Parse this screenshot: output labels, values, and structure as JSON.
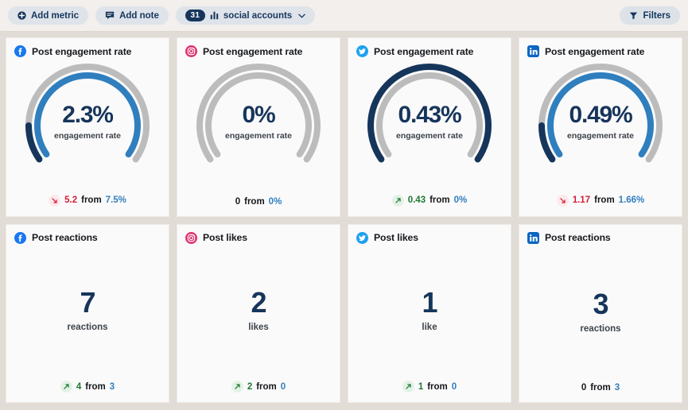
{
  "toolbar": {
    "add_metric_label": "Add metric",
    "add_note_label": "Add note",
    "accounts_count": "31",
    "accounts_label": "social accounts",
    "chevron": "⌄",
    "filters_label": "Filters",
    "icons": {
      "plus": "plus-circle-icon",
      "note": "note-icon",
      "bars": "bar-chart-icon",
      "funnel": "funnel-icon"
    }
  },
  "cards": [
    {
      "network": "facebook",
      "title": "Post engagement rate",
      "type": "gauge",
      "value": "2.3%",
      "unit_label": "engagement rate",
      "gauge": {
        "current_pct": 2.3,
        "previous_pct": 7.5,
        "max_pct": 7.5,
        "outer_mode": "previous",
        "inner_mode": "current"
      },
      "delta": {
        "direction": "down",
        "value": "5.2",
        "from_label": "from",
        "previous": "7.5%"
      }
    },
    {
      "network": "instagram",
      "title": "Post engagement rate",
      "type": "gauge",
      "value": "0%",
      "unit_label": "engagement rate",
      "gauge": {
        "current_pct": 0,
        "previous_pct": 0,
        "max_pct": 0,
        "outer_mode": "empty",
        "inner_mode": "empty"
      },
      "delta": {
        "direction": "none",
        "value": "0",
        "from_label": "from",
        "previous": "0%"
      }
    },
    {
      "network": "twitter",
      "title": "Post engagement rate",
      "type": "gauge",
      "value": "0.43%",
      "unit_label": "engagement rate",
      "gauge": {
        "current_pct": 0.43,
        "previous_pct": 0,
        "max_pct": 0.43,
        "outer_mode": "current-full",
        "inner_mode": "empty"
      },
      "delta": {
        "direction": "up",
        "value": "0.43",
        "from_label": "from",
        "previous": "0%"
      }
    },
    {
      "network": "linkedin",
      "title": "Post engagement rate",
      "type": "gauge",
      "value": "0.49%",
      "unit_label": "engagement rate",
      "gauge": {
        "current_pct": 0.49,
        "previous_pct": 1.66,
        "max_pct": 1.66,
        "outer_mode": "previous",
        "inner_mode": "current"
      },
      "delta": {
        "direction": "down",
        "value": "1.17",
        "from_label": "from",
        "previous": "1.66%"
      }
    },
    {
      "network": "facebook",
      "title": "Post reactions",
      "type": "number",
      "value": "7",
      "unit_label": "reactions",
      "delta": {
        "direction": "up",
        "value": "4",
        "from_label": "from",
        "previous": "3"
      }
    },
    {
      "network": "instagram",
      "title": "Post likes",
      "type": "number",
      "value": "2",
      "unit_label": "likes",
      "delta": {
        "direction": "up",
        "value": "2",
        "from_label": "from",
        "previous": "0"
      }
    },
    {
      "network": "twitter",
      "title": "Post likes",
      "type": "number",
      "value": "1",
      "unit_label": "like",
      "delta": {
        "direction": "up",
        "value": "1",
        "from_label": "from",
        "previous": "0"
      }
    },
    {
      "network": "linkedin",
      "title": "Post reactions",
      "type": "number",
      "value": "3",
      "unit_label": "reactions",
      "delta": {
        "direction": "none",
        "value": "0",
        "from_label": "from",
        "previous": "3"
      }
    }
  ],
  "colors": {
    "navy": "#16355b",
    "blue": "#2f7fbf",
    "gray_track": "#bcbcbc",
    "up_green": "#1e7a35",
    "down_red": "#d21f35",
    "page_bg": "#e2dcd6",
    "card_bg": "#fbfafa",
    "toolbar_bg": "#f2efec",
    "facebook": "#1877f2",
    "instagram": "#e1306c",
    "twitter": "#1da1f2",
    "linkedin": "#0a66c2"
  },
  "arrows": {
    "up": "↗",
    "down": "↘"
  }
}
